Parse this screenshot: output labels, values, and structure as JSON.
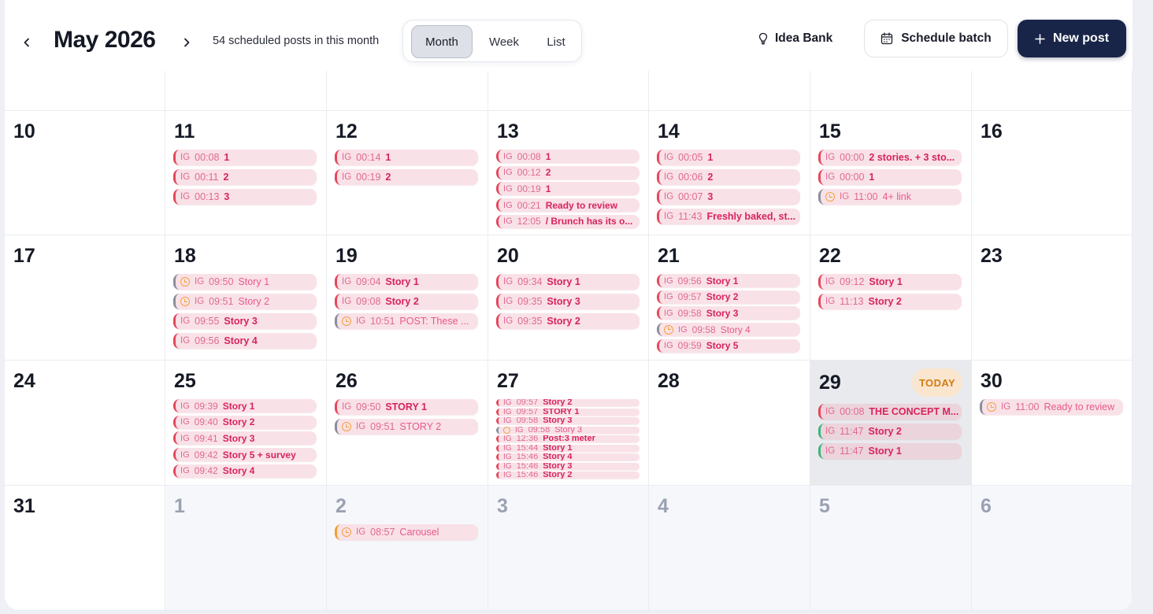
{
  "header": {
    "month_title": "May 2026",
    "prev_icon": "chevron-left-icon",
    "next_icon": "chevron-right-icon",
    "scheduled_count": "54 scheduled posts in this month",
    "views": [
      "Month",
      "Week",
      "List"
    ],
    "active_view": "Month",
    "idea_bank_label": "Idea Bank",
    "idea_bank_icon": "lightbulb-icon",
    "schedule_batch_label": "Schedule batch",
    "schedule_batch_icon": "calendar-icon",
    "new_post_label": "New post",
    "new_post_icon": "plus-icon",
    "primary_color": "#192548"
  },
  "calendar": {
    "today_label": "TODAY",
    "colors": {
      "post_bg": "#f9e1e8",
      "post_accent": "#e5475b",
      "today_bg": "#e9eaee",
      "today_badge": "#fae6cf"
    },
    "weeks": [
      [
        {
          "day": "",
          "posts": []
        },
        {
          "day": "",
          "posts": []
        },
        {
          "day": "",
          "posts": []
        },
        {
          "day": "",
          "posts": []
        },
        {
          "day": "",
          "posts": []
        },
        {
          "day": "",
          "posts": []
        },
        {
          "day": "",
          "posts": []
        }
      ],
      [
        {
          "day": "10",
          "posts": []
        },
        {
          "day": "11",
          "posts": [
            {
              "platform": "IG",
              "time": "00:08",
              "title": "1"
            },
            {
              "platform": "IG",
              "time": "00:11",
              "title": "2"
            },
            {
              "platform": "IG",
              "time": "00:13",
              "title": "3"
            }
          ]
        },
        {
          "day": "12",
          "posts": [
            {
              "platform": "IG",
              "time": "00:14",
              "title": "1"
            },
            {
              "platform": "IG",
              "time": "00:19",
              "title": "2"
            }
          ]
        },
        {
          "day": "13",
          "posts": [
            {
              "platform": "IG",
              "time": "00:08",
              "title": "1"
            },
            {
              "platform": "IG",
              "time": "00:12",
              "title": "2"
            },
            {
              "platform": "IG",
              "time": "00:19",
              "title": "1"
            },
            {
              "platform": "IG",
              "time": "00:21",
              "title": "Ready to review"
            },
            {
              "platform": "IG",
              "time": "12:05",
              "title": "/ Brunch has its o..."
            }
          ]
        },
        {
          "day": "14",
          "posts": [
            {
              "platform": "IG",
              "time": "00:05",
              "title": "1"
            },
            {
              "platform": "IG",
              "time": "00:06",
              "title": "2"
            },
            {
              "platform": "IG",
              "time": "00:07",
              "title": "3"
            },
            {
              "platform": "IG",
              "time": "11:43",
              "title": "Freshly baked, st..."
            }
          ]
        },
        {
          "day": "15",
          "posts": [
            {
              "platform": "IG",
              "time": "00:00",
              "title": "2 stories. + 3 sto..."
            },
            {
              "platform": "IG",
              "time": "00:00",
              "title": "1"
            },
            {
              "platform": "IG",
              "time": "11:00",
              "title": "4+ link",
              "pending": true
            }
          ]
        },
        {
          "day": "16",
          "posts": []
        }
      ],
      [
        {
          "day": "17",
          "posts": []
        },
        {
          "day": "18",
          "posts": [
            {
              "platform": "IG",
              "time": "09:50",
              "title": "Story 1",
              "pending": true
            },
            {
              "platform": "IG",
              "time": "09:51",
              "title": "Story 2",
              "pending": true
            },
            {
              "platform": "IG",
              "time": "09:55",
              "title": "Story 3"
            },
            {
              "platform": "IG",
              "time": "09:56",
              "title": "Story 4"
            }
          ]
        },
        {
          "day": "19",
          "posts": [
            {
              "platform": "IG",
              "time": "09:04",
              "title": "Story 1"
            },
            {
              "platform": "IG",
              "time": "09:08",
              "title": "Story 2"
            },
            {
              "platform": "IG",
              "time": "10:51",
              "title": "POST: These ...",
              "pending": true
            }
          ]
        },
        {
          "day": "20",
          "posts": [
            {
              "platform": "IG",
              "time": "09:34",
              "title": "Story 1"
            },
            {
              "platform": "IG",
              "time": "09:35",
              "title": "Story 3"
            },
            {
              "platform": "IG",
              "time": "09:35",
              "title": "Story 2"
            }
          ]
        },
        {
          "day": "21",
          "posts": [
            {
              "platform": "IG",
              "time": "09:56",
              "title": "Story 1"
            },
            {
              "platform": "IG",
              "time": "09:57",
              "title": "Story 2"
            },
            {
              "platform": "IG",
              "time": "09:58",
              "title": "Story 3"
            },
            {
              "platform": "IG",
              "time": "09:58",
              "title": "Story 4",
              "pending": true
            },
            {
              "platform": "IG",
              "time": "09:59",
              "title": "Story 5"
            }
          ]
        },
        {
          "day": "22",
          "posts": [
            {
              "platform": "IG",
              "time": "09:12",
              "title": "Story 1"
            },
            {
              "platform": "IG",
              "time": "11:13",
              "title": "Story 2"
            }
          ]
        },
        {
          "day": "23",
          "posts": []
        }
      ],
      [
        {
          "day": "24",
          "posts": []
        },
        {
          "day": "25",
          "posts": [
            {
              "platform": "IG",
              "time": "09:39",
              "title": "Story 1"
            },
            {
              "platform": "IG",
              "time": "09:40",
              "title": "Story 2"
            },
            {
              "platform": "IG",
              "time": "09:41",
              "title": "Story 3"
            },
            {
              "platform": "IG",
              "time": "09:42",
              "title": "Story 5 + survey"
            },
            {
              "platform": "IG",
              "time": "09:42",
              "title": "Story 4"
            }
          ]
        },
        {
          "day": "26",
          "posts": [
            {
              "platform": "IG",
              "time": "09:50",
              "title": "STORY 1"
            },
            {
              "platform": "IG",
              "time": "09:51",
              "title": "STORY 2",
              "pending": true
            }
          ]
        },
        {
          "day": "27",
          "posts": [
            {
              "platform": "IG",
              "time": "09:57",
              "title": "Story 2"
            },
            {
              "platform": "IG",
              "time": "09:57",
              "title": "STORY 1"
            },
            {
              "platform": "IG",
              "time": "09:58",
              "title": "Story 3"
            },
            {
              "platform": "IG",
              "time": "09:58",
              "title": "Story 3",
              "pending": true
            },
            {
              "platform": "IG",
              "time": "12:36",
              "title": "Post:3 meter"
            },
            {
              "platform": "IG",
              "time": "15:44",
              "title": "Story 1"
            },
            {
              "platform": "IG",
              "time": "15:46",
              "title": "Story 4"
            },
            {
              "platform": "IG",
              "time": "15:46",
              "title": "Story 3"
            },
            {
              "platform": "IG",
              "time": "15:46",
              "title": "Story 2"
            }
          ]
        },
        {
          "day": "28",
          "posts": []
        },
        {
          "day": "29",
          "today": true,
          "posts": [
            {
              "platform": "IG",
              "time": "00:08",
              "title": "THE CONCEPT M..."
            },
            {
              "platform": "IG",
              "time": "11:47",
              "title": "Story 2",
              "status": "green"
            },
            {
              "platform": "IG",
              "time": "11:47",
              "title": "Story 1",
              "status": "green"
            }
          ]
        },
        {
          "day": "30",
          "posts": [
            {
              "platform": "IG",
              "time": "11:00",
              "title": "Ready to review",
              "pending": true
            }
          ]
        }
      ],
      [
        {
          "day": "31",
          "posts": []
        },
        {
          "day": "1",
          "other": true,
          "posts": []
        },
        {
          "day": "2",
          "other": true,
          "posts": [
            {
              "platform": "IG",
              "time": "08:57",
              "title": "Carousel",
              "pending": true,
              "status": "orange"
            }
          ]
        },
        {
          "day": "3",
          "other": true,
          "posts": []
        },
        {
          "day": "4",
          "other": true,
          "posts": []
        },
        {
          "day": "5",
          "other": true,
          "posts": []
        },
        {
          "day": "6",
          "other": true,
          "posts": []
        }
      ]
    ]
  }
}
